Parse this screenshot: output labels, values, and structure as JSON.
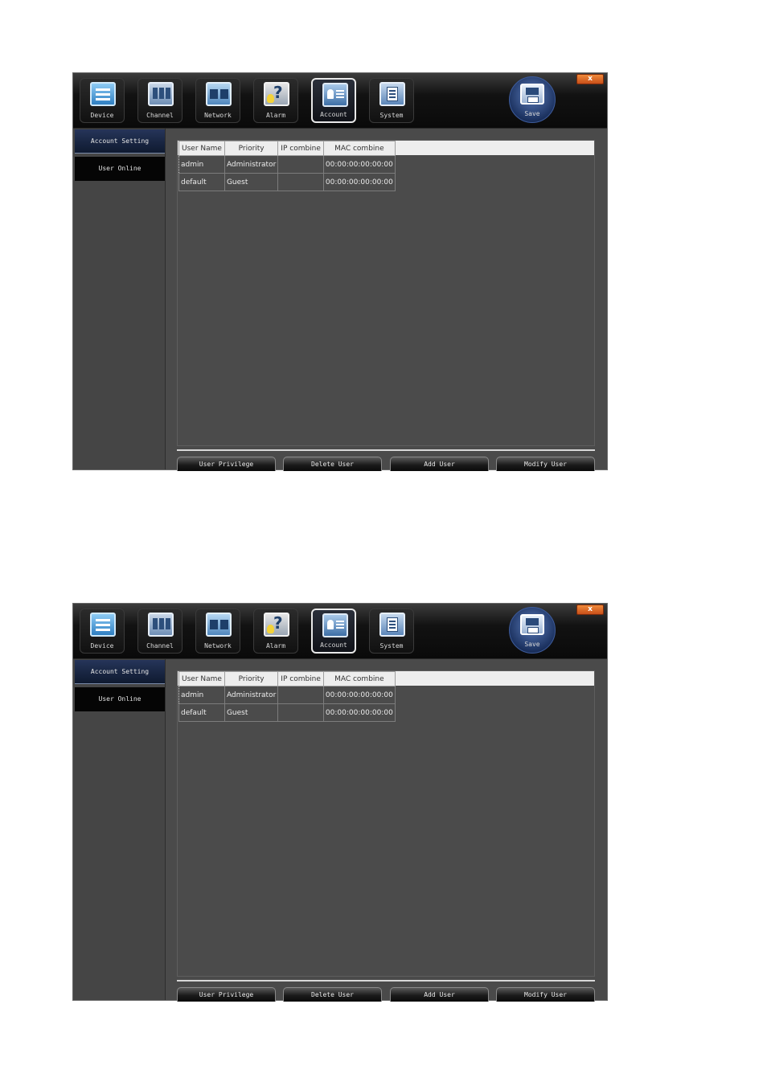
{
  "window": {
    "close_label": "x",
    "nav_tabs": [
      {
        "label": "Device",
        "icon": "device-icon",
        "active": false
      },
      {
        "label": "Channel",
        "icon": "channel-icon",
        "active": false
      },
      {
        "label": "Network",
        "icon": "network-icon",
        "active": false
      },
      {
        "label": "Alarm",
        "icon": "alarm-icon",
        "active": false
      },
      {
        "label": "Account",
        "icon": "account-icon",
        "active": true
      },
      {
        "label": "System",
        "icon": "system-icon",
        "active": false
      }
    ],
    "save_label": "Save",
    "sidebar": [
      {
        "label": "Account Setting",
        "active": true
      },
      {
        "label": "User Online",
        "active": false
      }
    ],
    "table": {
      "headers": [
        "User Name",
        "Priority",
        "IP combine",
        "MAC combine"
      ],
      "rows": [
        [
          "admin",
          "Administrator",
          "",
          "00:00:00:00:00:00"
        ],
        [
          "default",
          "Guest",
          "",
          "00:00:00:00:00:00"
        ]
      ]
    },
    "buttons": [
      "User Privilege",
      "Delete User",
      "Add User",
      "Modify User"
    ]
  },
  "colors": {
    "window_bg": "#4a4a4a",
    "titlebar_bg": "#0a0a0a",
    "active_sidebar_bg": "#1a2744",
    "close_button": "#e06a2a",
    "save_button": "#1c3260"
  }
}
